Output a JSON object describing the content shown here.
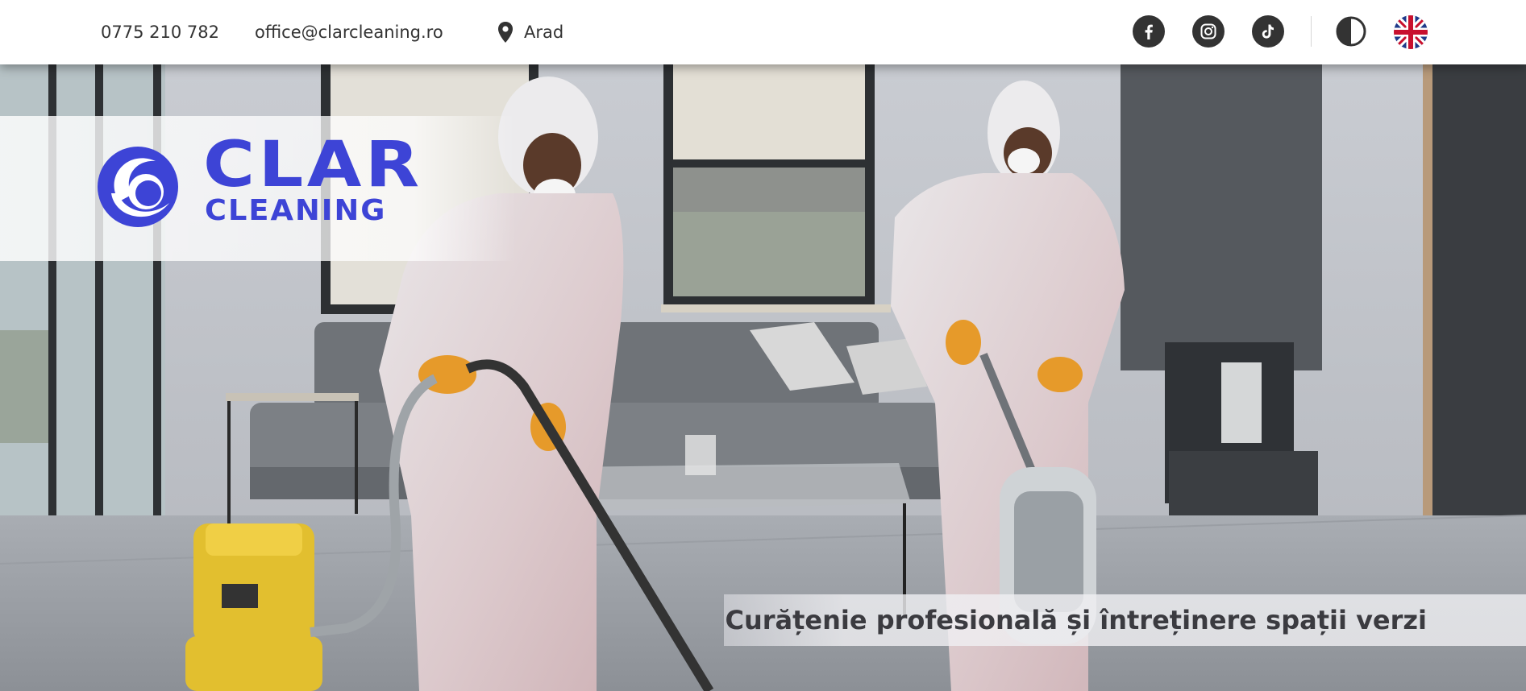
{
  "topbar": {
    "phone": "0775 210 782",
    "email": "office@clarcleaning.ro",
    "location": "Arad",
    "location_icon": "map-pin-icon",
    "social": [
      {
        "name": "facebook",
        "icon": "facebook-icon"
      },
      {
        "name": "instagram",
        "icon": "instagram-icon"
      },
      {
        "name": "tiktok",
        "icon": "tiktok-icon"
      }
    ],
    "contrast_icon": "contrast-icon",
    "language_icon": "uk-flag-icon"
  },
  "logo": {
    "line1": "CLAR",
    "line2": "CLEANING",
    "color": "#3d44d6"
  },
  "hero": {
    "tagline": "Curățenie profesională și întreținere spații verzi"
  },
  "colors": {
    "text": "#333333",
    "brand": "#3d44d6",
    "icon_bg": "#333333"
  }
}
